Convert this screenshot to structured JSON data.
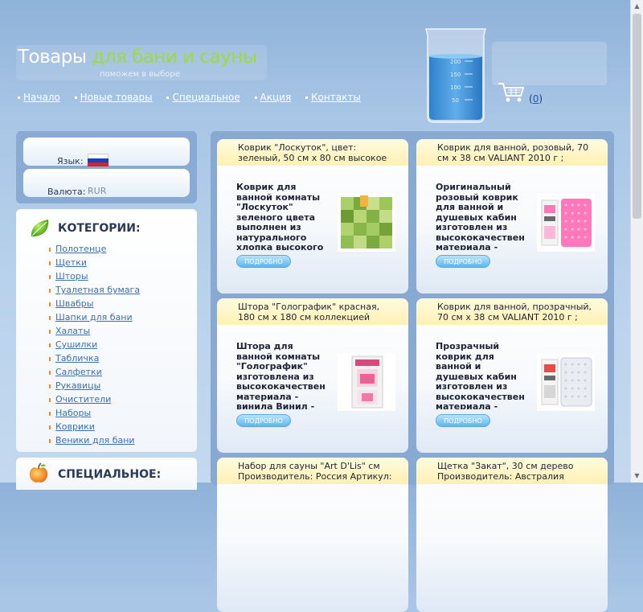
{
  "header": {
    "title_white": "Товары",
    "title_green": "для бани и сауны",
    "tagline": "поможем в выборе",
    "nav": [
      {
        "label": "Начало"
      },
      {
        "label": "Новые товары"
      },
      {
        "label": "Специальное"
      },
      {
        "label": "Акция"
      },
      {
        "label": "Контакты"
      }
    ],
    "beaker_marks": [
      "200",
      "150",
      "100",
      "50"
    ],
    "cart": {
      "open": "(",
      "count": "0",
      "close": ")"
    }
  },
  "sidebar": {
    "language_label": "Язык:",
    "currency_label": "Валюта:",
    "currency_value": "RUR",
    "categories_title": "КОТЕГОРИИ:",
    "categories": [
      {
        "label": "Полотенце"
      },
      {
        "label": "Щетки"
      },
      {
        "label": "Шторы"
      },
      {
        "label": "Туалетная бумага"
      },
      {
        "label": "Швабры"
      },
      {
        "label": "Шапки для бани"
      },
      {
        "label": "Халаты"
      },
      {
        "label": "Сушилки"
      },
      {
        "label": "Табличка"
      },
      {
        "label": "Салфетки"
      },
      {
        "label": "Рукавицы"
      },
      {
        "label": "Очистители"
      },
      {
        "label": "Наборы"
      },
      {
        "label": "Коврики"
      },
      {
        "label": "Веники для бани"
      }
    ],
    "special_title": "СПЕЦИАЛЬНОЕ:"
  },
  "products": [
    {
      "title": "Коврик \"Лоскуток\", цвет: зеленый, 50 см х 80 см высокое",
      "desc": "Коврик для ванной комнаты \"Лоскуток\" зеленого цвета выполнен из натурального хлопка высокого",
      "button": "ПОДРОБНО",
      "image_icon": "green-patchwork-rug"
    },
    {
      "title": "Коврик для ванной, розовый, 70 см х 38 см VALIANT 2010 г ;",
      "desc": "Оригинальный розовый коврик для ванной и душевых кабин изготовлен из высококачественного материала - винила",
      "button": "ПОДРОБНО",
      "image_icon": "pink-bath-mat"
    },
    {
      "title": "Штора \"Голографик\" красная, 180 см х 180 см коллекцией ковриков",
      "desc": "Штора для ванной комнаты \"Голографик\" изготовлена из высококачественного материала - винила Винил -",
      "button": "ПОДРОБНО",
      "image_icon": "red-curtain-package"
    },
    {
      "title": "Коврик для ванной, прозрачный, 70 см х 38 см VALIANT 2010 г ;",
      "desc": "Прозрачный коврик для ванной и душевых кабин изготовлен из высококачественного материала - винила Винил -",
      "button": "ПОДРОБНО",
      "image_icon": "clear-bath-mat"
    },
    {
      "title": "Набор для сауны \"Art D'Lis\" см Производитель: Россия Артикул:",
      "desc": "",
      "button": "",
      "image_icon": ""
    },
    {
      "title": "Щетка \"Закат\", 30 см дерево Производитель: Австралия",
      "desc": "",
      "button": "",
      "image_icon": ""
    }
  ],
  "colors": {
    "accent_green": "#9bdc3c",
    "link_blue": "#3a6fb1",
    "panel_blue": "#88aad2",
    "card_header": "#fff1b3",
    "button_blue": "#5eb6ee"
  }
}
